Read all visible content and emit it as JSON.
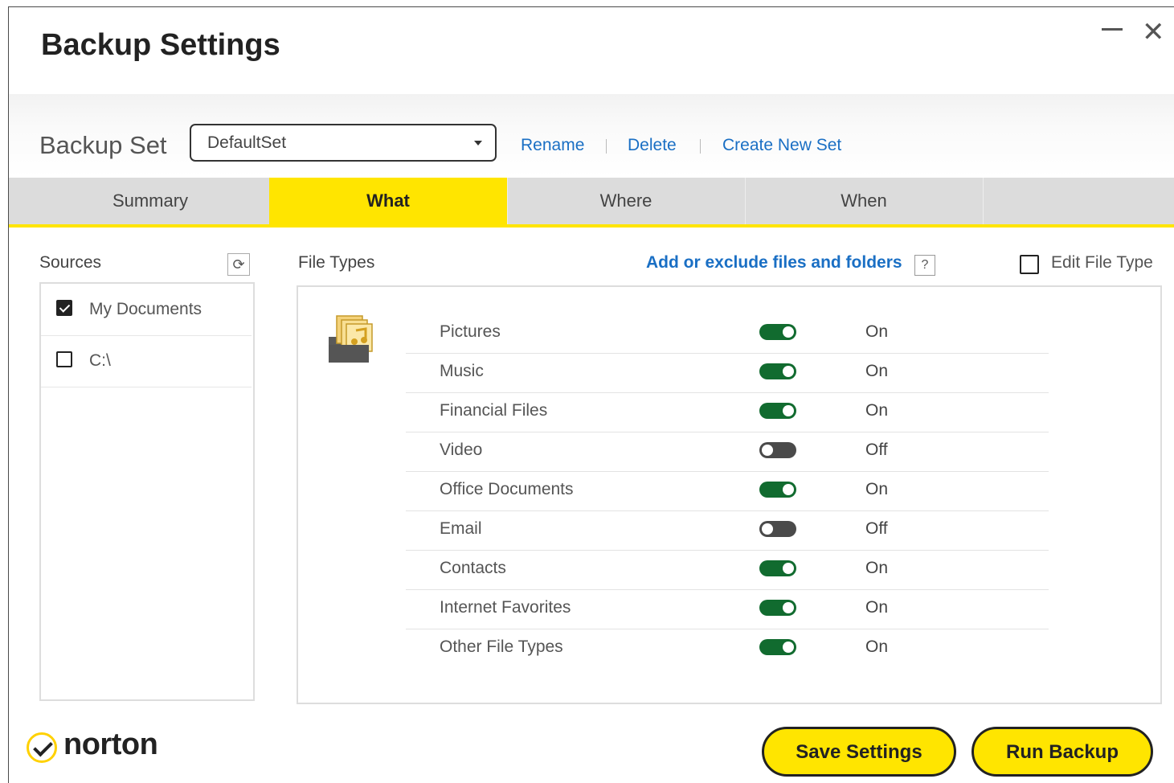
{
  "window": {
    "title": "Backup Settings",
    "minimize_icon": "minimize-icon",
    "close_icon": "close-icon"
  },
  "backup_set": {
    "label": "Backup Set",
    "selected": "DefaultSet",
    "links": [
      "Rename",
      "Delete",
      "Create New Set"
    ]
  },
  "tabs": [
    {
      "label": "Summary",
      "active": false
    },
    {
      "label": "What",
      "active": true
    },
    {
      "label": "Where",
      "active": false
    },
    {
      "label": "When",
      "active": false
    }
  ],
  "sources": {
    "label": "Sources",
    "refresh_icon": "refresh-icon",
    "items": [
      {
        "label": "My Documents",
        "checked": true
      },
      {
        "label": "C:\\",
        "checked": false
      }
    ]
  },
  "file_types": {
    "label": "File Types",
    "add_link": "Add or exclude files and folders",
    "help": "?",
    "edit_label": "Edit File Type",
    "icon": "folder-files-icon",
    "items": [
      {
        "name": "Pictures",
        "state": "On"
      },
      {
        "name": "Music",
        "state": "On"
      },
      {
        "name": "Financial Files",
        "state": "On"
      },
      {
        "name": "Video",
        "state": "Off"
      },
      {
        "name": "Office Documents",
        "state": "On"
      },
      {
        "name": "Email",
        "state": "Off"
      },
      {
        "name": "Contacts",
        "state": "On"
      },
      {
        "name": "Internet Favorites",
        "state": "On"
      },
      {
        "name": "Other File Types",
        "state": "On"
      }
    ]
  },
  "footer": {
    "logo": "norton",
    "save_label": "Save Settings",
    "run_label": "Run Backup"
  },
  "colors": {
    "accent": "#ffe500",
    "toggle_on": "#116b2f",
    "toggle_off": "#4a4a4a",
    "link": "#1a6fc4"
  }
}
